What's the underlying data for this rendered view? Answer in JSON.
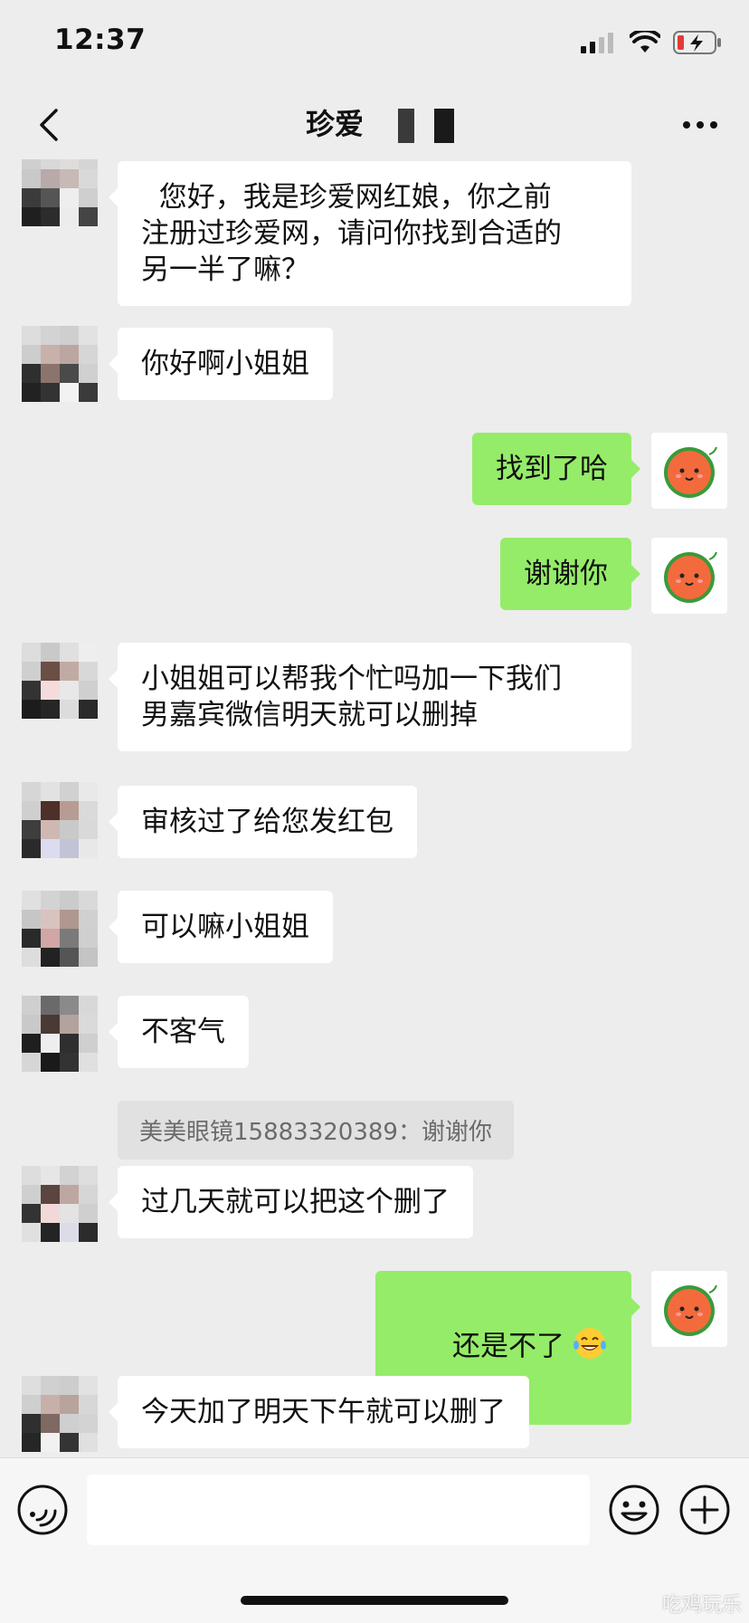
{
  "status_bar": {
    "time": "12:37"
  },
  "nav": {
    "title": "珍爱"
  },
  "messages": [
    {
      "side": "left",
      "text": "  您好，我是珍爱网红娘，你之前\n注册过珍爱网，请问你找到合适的\n另一半了嘛？"
    },
    {
      "side": "left",
      "text": "你好啊小姐姐"
    },
    {
      "side": "right",
      "text": "找到了哈"
    },
    {
      "side": "right",
      "text": "谢谢你"
    },
    {
      "side": "left",
      "text": "小姐姐可以帮我个忙吗加一下我们\n男嘉宾微信明天就可以删掉"
    },
    {
      "side": "left",
      "text": "审核过了给您发红包"
    },
    {
      "side": "left",
      "text": "可以嘛小姐姐"
    },
    {
      "side": "left",
      "text": "不客气",
      "quote": "美美眼镜15883320389：谢谢你"
    },
    {
      "side": "left",
      "text": "过几天就可以把这个删了"
    },
    {
      "side": "right",
      "text": "还是不了",
      "emoji": "laughing-tears-emoji"
    },
    {
      "side": "left",
      "text": "今天加了明天下午就可以删了"
    }
  ],
  "input_bar": {
    "value": "",
    "placeholder": ""
  },
  "watermark": "吃鸡玩乐",
  "colors": {
    "background": "#ededed",
    "self_bubble": "#95ec69",
    "other_bubble": "#ffffff",
    "quote_bg": "#e1e1e1"
  },
  "icons": [
    "back-chevron-icon",
    "more-icon",
    "voice-icon",
    "emoji-icon",
    "plus-icon",
    "watermelon-avatar-icon"
  ]
}
